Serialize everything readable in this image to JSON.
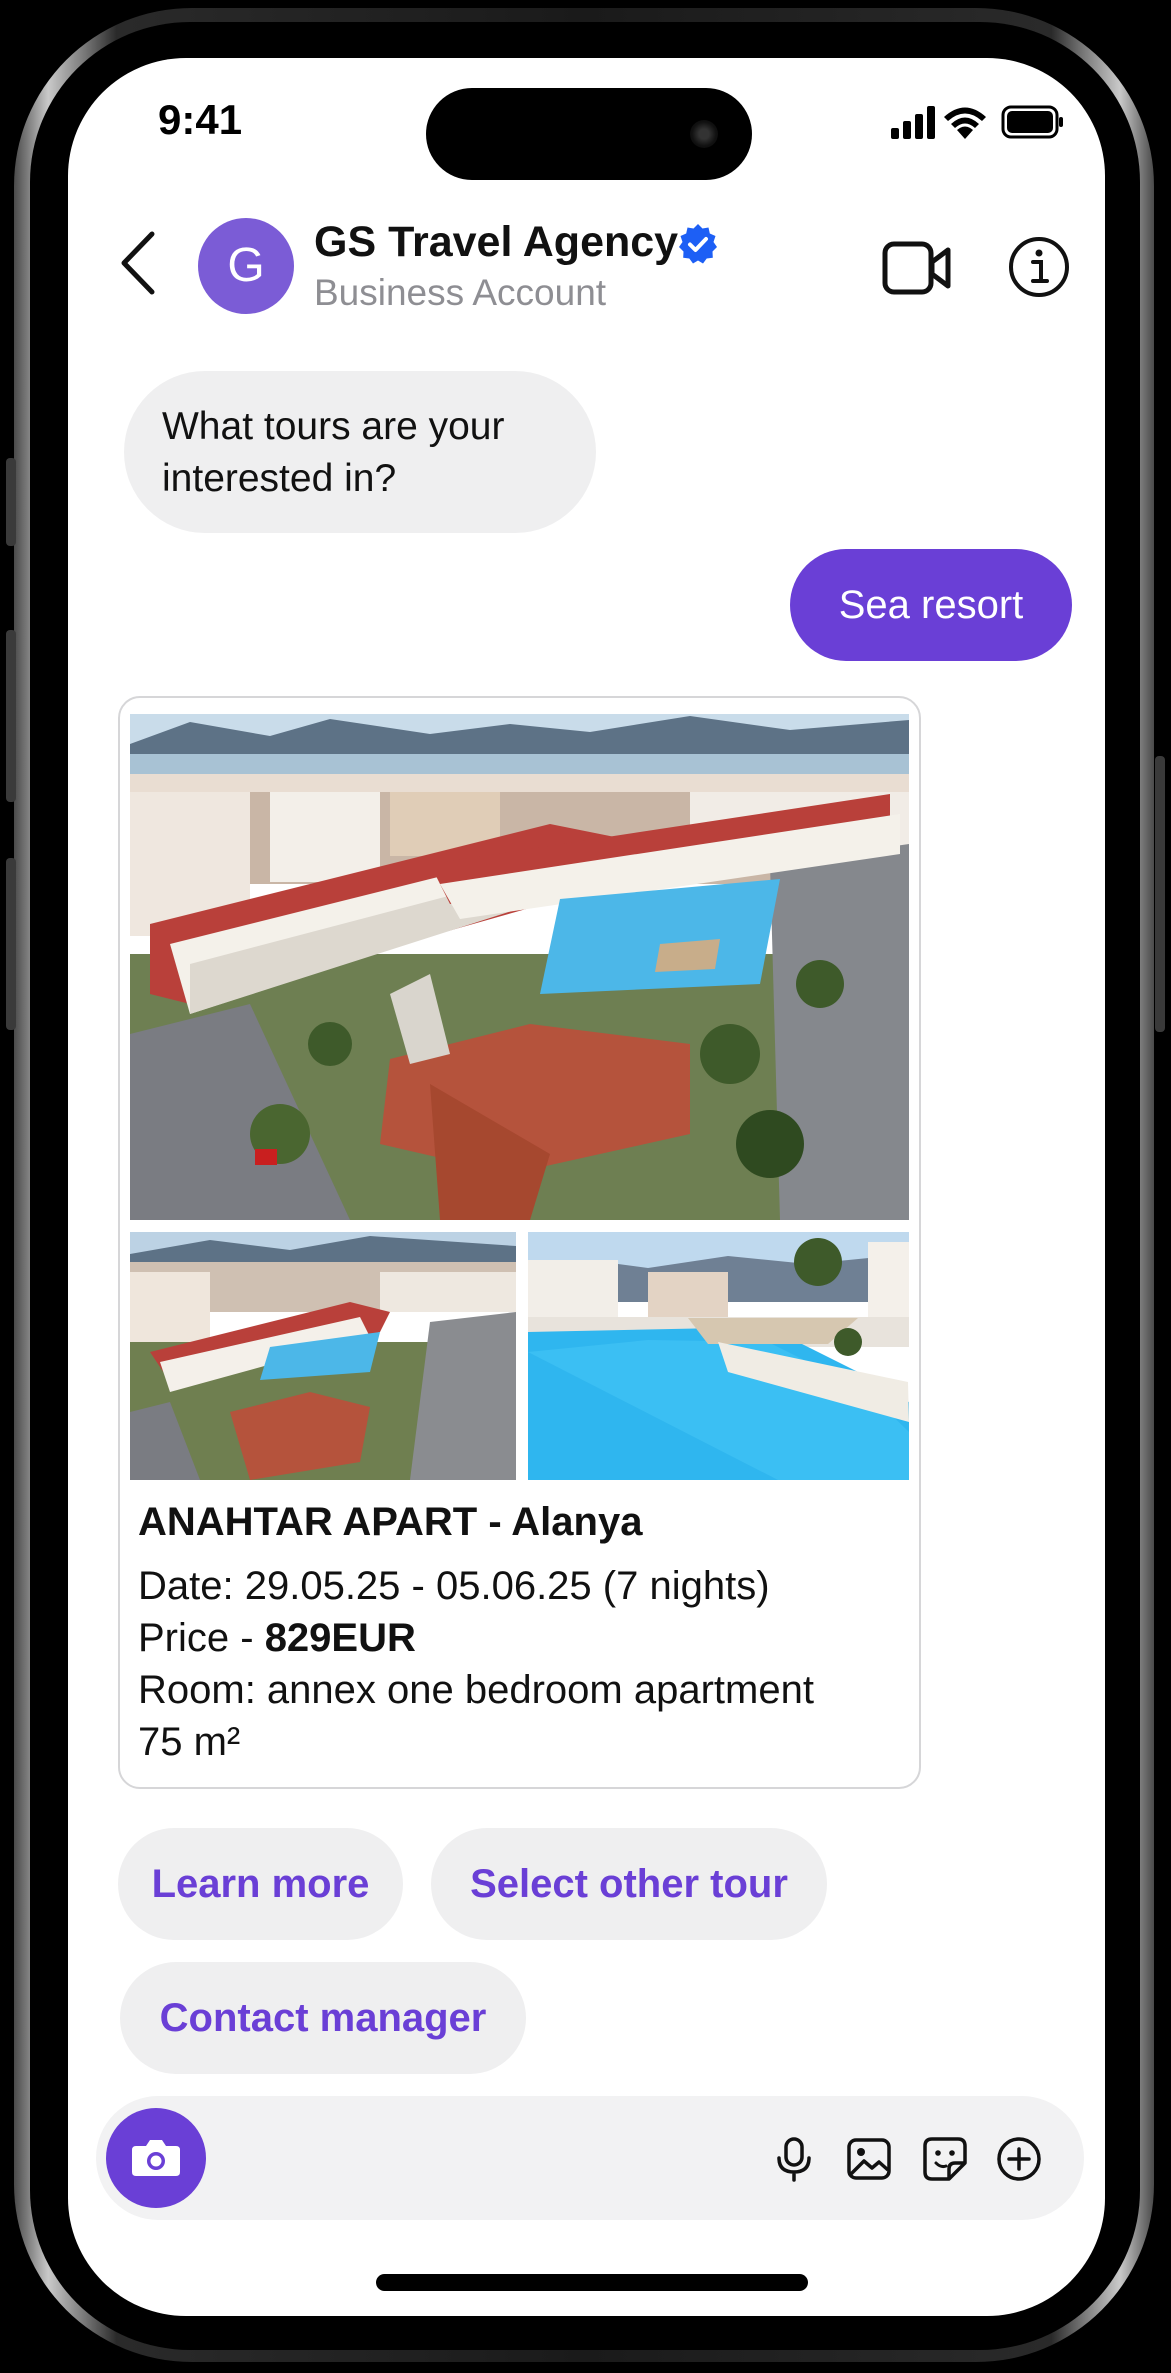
{
  "status": {
    "time": "9:41"
  },
  "header": {
    "avatar_letter": "G",
    "name": "GS Travel Agency",
    "subtitle": "Business Account"
  },
  "messages": {
    "incoming": "What tours are your interested in?",
    "outgoing": "Sea resort"
  },
  "tour_card": {
    "title": "ANAHTAR APART - Alanya",
    "date_line": "Date: 29.05.25 - 05.06.25 (7 nights)",
    "price_label": "Price - ",
    "price_value": "829EUR",
    "room_line_1": "Room: annex one bedroom apartment",
    "room_line_2": "75 m²"
  },
  "quick_replies": {
    "learn_more": "Learn more",
    "select_other": "Select other tour",
    "contact_manager": "Contact manager"
  },
  "colors": {
    "accent": "#6a3fd6",
    "avatar": "#7b5cd6",
    "verified": "#1d5ff5",
    "bubble_gray": "#efeff0"
  },
  "icons": [
    "back-chevron-icon",
    "verified-badge-icon",
    "video-camera-icon",
    "info-icon",
    "camera-icon",
    "microphone-icon",
    "gallery-icon",
    "sticker-icon",
    "plus-icon"
  ]
}
